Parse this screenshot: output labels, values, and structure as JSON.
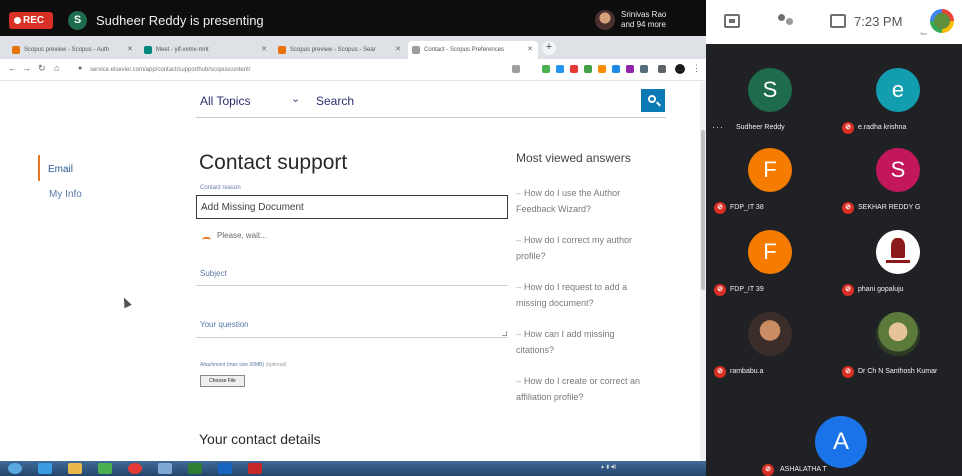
{
  "meeting": {
    "rec_label": "REC",
    "presenter_initial": "S",
    "presenter_text": "Sudheer Reddy is presenting",
    "others_line1": "Srinivas Rao",
    "others_line2": "and 94 more"
  },
  "browser": {
    "tabs": [
      {
        "label": "Scopus preview - Scopus - Auth"
      },
      {
        "label": "Meet - yif-xvmv-mnt"
      },
      {
        "label": "Scopus preview - Scopus - Sear"
      },
      {
        "label": "Contact - Scopus Preferences"
      }
    ],
    "new_tab": "+",
    "url": "service.elsevier.com/app/contact/supporthub/scopuscontent/"
  },
  "page": {
    "topic_select": "All Topics",
    "search_placeholder": "Search",
    "side_nav": [
      "Email",
      "My Info"
    ],
    "form_title": "Contact support",
    "reason_label": "Contact reason",
    "reason_value": "Add Missing Document",
    "waiting_text": "Please, wait...",
    "subject_label": "Subject",
    "question_label": "Your question",
    "attach_label": "Attachment (max size 20MB)",
    "attach_optional": "(optional)",
    "choose_file": "Choose File",
    "contact_details_title": "Your contact details",
    "mva_title": "Most viewed answers",
    "mva_items": [
      {
        "line1": "How do I use the Author",
        "line2": "Feedback Wizard?"
      },
      {
        "line1": "How do I correct my author",
        "line2": "profile?"
      },
      {
        "line1": "How do I request to add a",
        "line2": "missing document?"
      },
      {
        "line1": "How can I add missing",
        "line2": "citations?"
      },
      {
        "line1": "How do I create or correct an",
        "line2": "affiliation profile?"
      }
    ]
  },
  "tray": {
    "time": "7:23 PM",
    "you_label": "You"
  },
  "participants": [
    {
      "initial": "S",
      "name": "Sudheer Reddy",
      "color": "#1e6b4e"
    },
    {
      "initial": "e",
      "name": "e.radha krishna",
      "color": "#129eaf"
    },
    {
      "initial": "F",
      "name": "FDP_IT 38",
      "color": "#f57c00"
    },
    {
      "initial": "S",
      "name": "SEKHAR REDDY G",
      "color": "#c2185b"
    },
    {
      "initial": "F",
      "name": "FDP_IT 39",
      "color": "#f57c00"
    },
    {
      "initial": "",
      "name": "phani gopaluju",
      "color": "#ffffff"
    },
    {
      "initial": "",
      "name": "rambabu.a",
      "color": "#3a2d2a"
    },
    {
      "initial": "",
      "name": "Dr Ch N Santhosh Kumar",
      "color": "#5c7a3c"
    }
  ],
  "big_participant": {
    "initial": "A",
    "name": "ASHALATHA T"
  }
}
